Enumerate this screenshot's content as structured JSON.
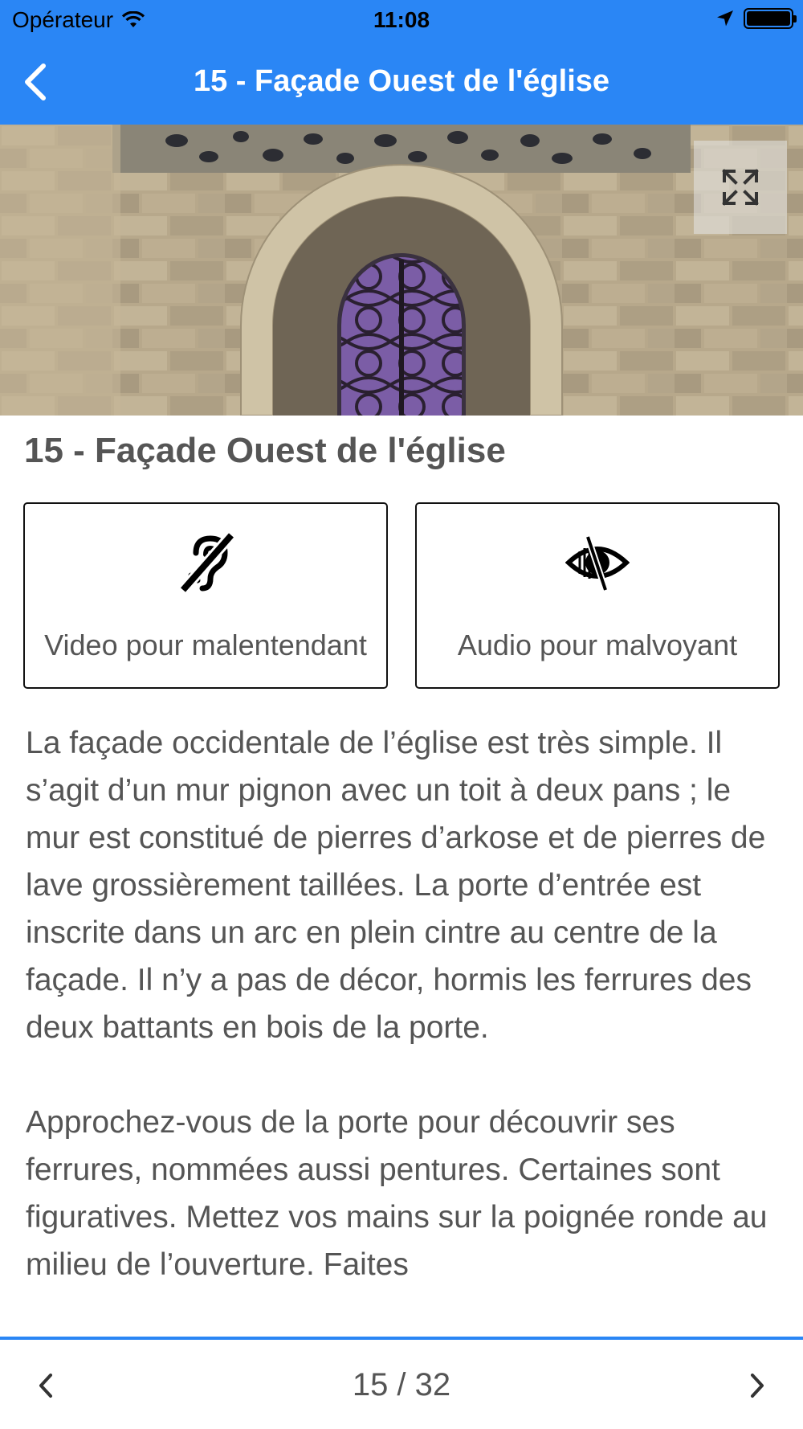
{
  "status_bar": {
    "carrier": "Opérateur",
    "time": "11:08"
  },
  "nav": {
    "title": "15 - Façade Ouest de l'église",
    "back_icon": "chevron-left-icon"
  },
  "hero": {
    "expand_icon": "expand-icon"
  },
  "content": {
    "title": "15 - Façade Ouest de l'église",
    "buttons": [
      {
        "label": "Video pour malentendant",
        "icon": "hearing-impaired-icon"
      },
      {
        "label": "Audio pour malvoyant",
        "icon": "visually-impaired-icon"
      }
    ],
    "paragraphs": [
      "La façade occidentale de l’église est très simple. Il s’agit d’un mur pignon avec un toit à deux pans ; le mur est constitué de pierres d’arkose et de pierres de lave grossièrement taillées. La porte d’entrée est inscrite dans un arc en plein cintre au centre de la façade. Il n’y a pas de décor, hormis les ferrures des deux battants en bois de la porte.",
      "Approchez-vous de la porte pour découvrir ses ferrures, nommées aussi pentures. Certaines sont figuratives. Mettez vos mains sur la poignée ronde au milieu de l’ouverture. Faites"
    ]
  },
  "pagination": {
    "label": "15 / 32",
    "current": 15,
    "total": 32
  },
  "colors": {
    "accent": "#2a86f5",
    "text": "#555555"
  }
}
